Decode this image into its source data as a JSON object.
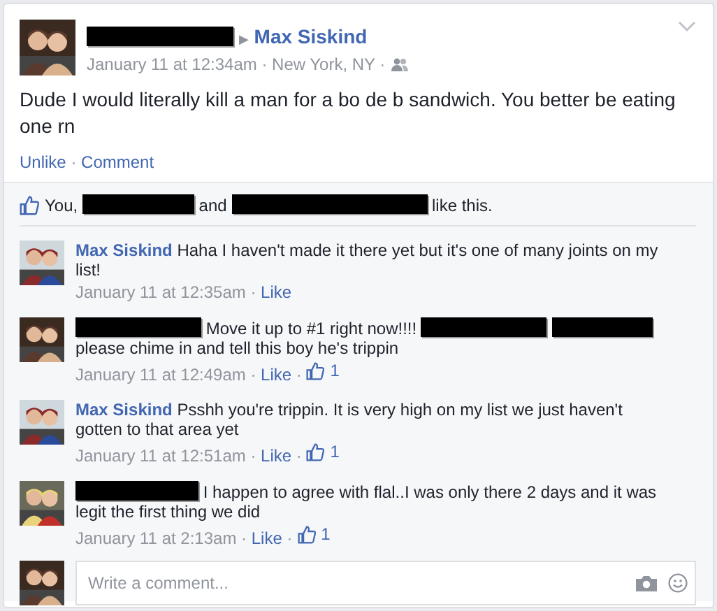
{
  "post": {
    "header": [
      {
        "kind": "redacted"
      },
      {
        "kind": "arrow",
        "text": "▶"
      },
      {
        "kind": "author",
        "text": "Max Siskind"
      }
    ],
    "meta": "January 11 at 12:34am · New York, NY ·",
    "text": "Dude I would literally kill a man for a bo de b sandwich. You better be eating one rn",
    "actions": [
      {
        "kind": "link",
        "text": "Unlike"
      },
      {
        "kind": "sep",
        "text": "·"
      },
      {
        "kind": "link",
        "text": "Comment"
      }
    ]
  },
  "likes": [
    {
      "kind": "text",
      "text": "You,"
    },
    {
      "kind": "redacted"
    },
    {
      "kind": "text",
      "text": "and"
    },
    {
      "kind": "redacted"
    },
    {
      "kind": "text",
      "text": "like this."
    }
  ],
  "comments": [
    {
      "body": [
        {
          "kind": "author",
          "text": "Max Siskind"
        },
        {
          "kind": "text",
          "text": "Haha I haven't made it there yet but it's one of many joints on my list!"
        }
      ],
      "meta": [
        {
          "kind": "time",
          "text": "January 11 at 12:35am"
        },
        {
          "kind": "sep",
          "text": "·"
        },
        {
          "kind": "link",
          "text": "Like"
        }
      ]
    },
    {
      "body": [
        {
          "kind": "redacted"
        },
        {
          "kind": "text",
          "text": "Move it up to #1 right now!!!!"
        },
        {
          "kind": "redacted"
        },
        {
          "kind": "redacted"
        },
        {
          "kind": "text",
          "text": "please chime in and tell this boy he's trippin"
        }
      ],
      "meta": [
        {
          "kind": "time",
          "text": "January 11 at 12:49am"
        },
        {
          "kind": "sep",
          "text": "·"
        },
        {
          "kind": "link",
          "text": "Like"
        },
        {
          "kind": "sep",
          "text": "·"
        },
        {
          "kind": "likes",
          "text": "1"
        }
      ]
    },
    {
      "body": [
        {
          "kind": "author",
          "text": "Max Siskind"
        },
        {
          "kind": "text",
          "text": "Psshh you're trippin. It is very high on my list we just haven't gotten to that area yet"
        }
      ],
      "meta": [
        {
          "kind": "time",
          "text": "January 11 at 12:51am"
        },
        {
          "kind": "sep",
          "text": "·"
        },
        {
          "kind": "link",
          "text": "Like"
        },
        {
          "kind": "sep",
          "text": "·"
        },
        {
          "kind": "likes",
          "text": "1"
        }
      ]
    },
    {
      "body": [
        {
          "kind": "redacted"
        },
        {
          "kind": "text",
          "text": "I happen to agree with flal..I was only there 2 days and it was legit the first thing we did"
        }
      ],
      "meta": [
        {
          "kind": "time",
          "text": "January 11 at 2:13am"
        },
        {
          "kind": "sep",
          "text": "·"
        },
        {
          "kind": "link",
          "text": "Like"
        },
        {
          "kind": "sep",
          "text": "·"
        },
        {
          "kind": "likes",
          "text": "1"
        }
      ]
    }
  ],
  "composer": {
    "placeholder": "Write a comment..."
  }
}
